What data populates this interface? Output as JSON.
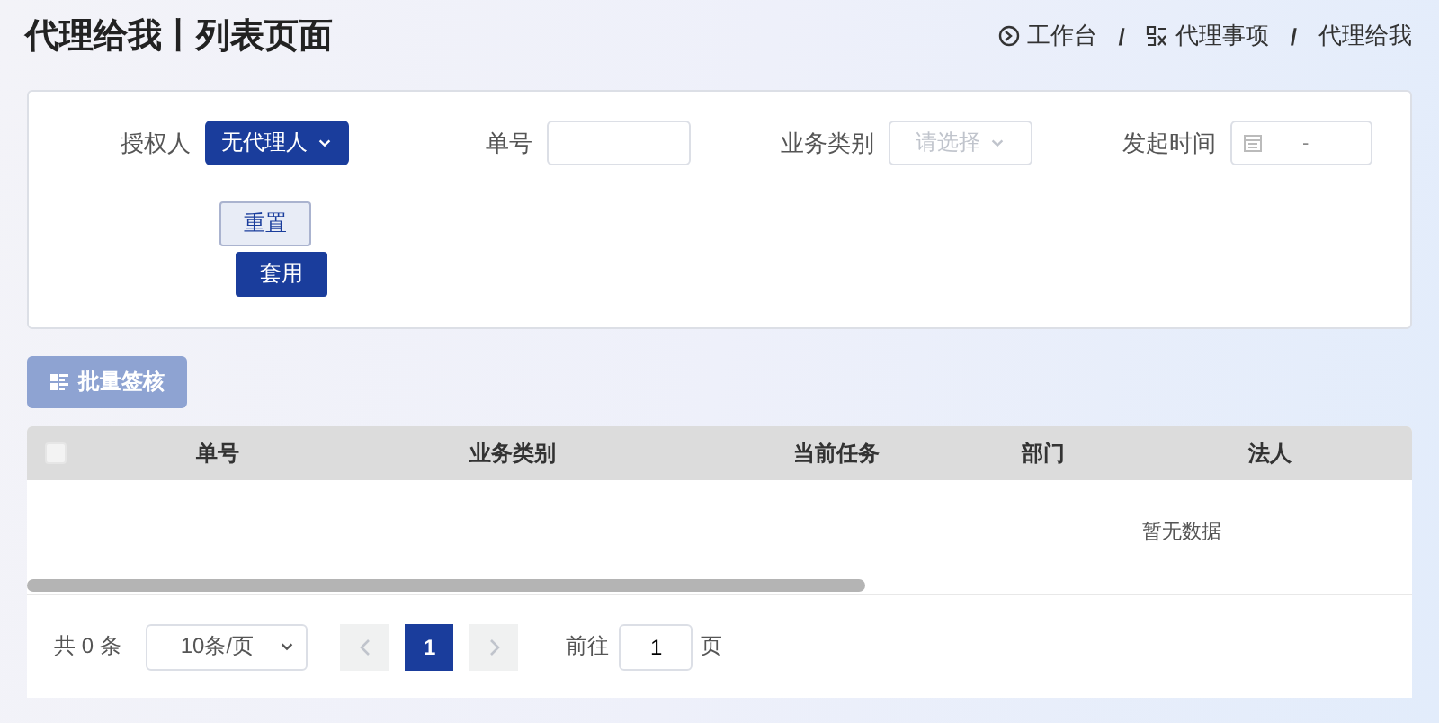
{
  "page_title": "代理给我丨列表页面",
  "breadcrumb": [
    {
      "label": "工作台",
      "kind": "home"
    },
    {
      "label": "代理事项",
      "kind": "section"
    },
    {
      "label": "代理给我",
      "kind": "current"
    }
  ],
  "breadcrumb_separator": "/",
  "filters": [
    {
      "kind": "select",
      "label": "授权人",
      "value": "无代理人",
      "filled": true
    },
    {
      "kind": "input",
      "label": "单号"
    },
    {
      "kind": "select",
      "label": "业务类别",
      "placeholder": "请选择",
      "filled": false
    },
    {
      "kind": "date",
      "label": "发起时间",
      "separator": "-"
    }
  ],
  "reset_button": "重置",
  "apply_button": "套用",
  "batch_button": {
    "label": "批量签核",
    "disabled": true
  },
  "table": {
    "select_all_checked": false,
    "columns": [
      "单号",
      "业务类别",
      "当前任务",
      "部门",
      "法人"
    ],
    "empty_text": "暂无数据"
  },
  "pagination": {
    "total": "共 0 条",
    "page_size": "10条/页",
    "prev_disabled": true,
    "next_disabled": true,
    "pages": [
      {
        "label": "1",
        "selected": true
      }
    ],
    "goto_label": "前往",
    "goto_value": "1",
    "goto_suffix": "页"
  }
}
